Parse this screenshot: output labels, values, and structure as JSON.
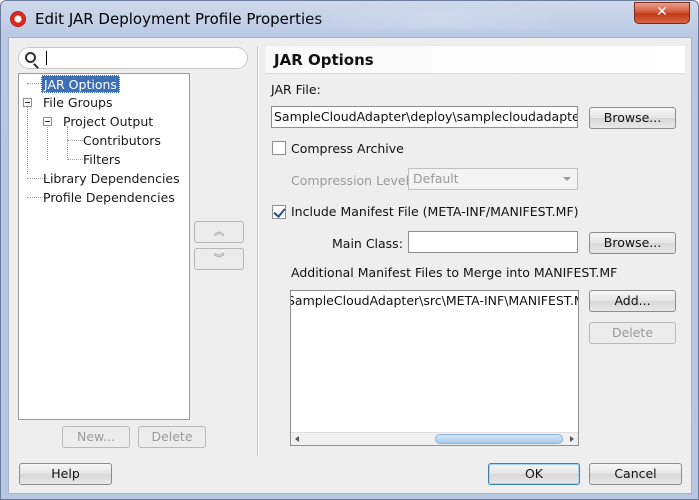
{
  "window": {
    "title": "Edit JAR Deployment Profile Properties",
    "close_symbol": "✕"
  },
  "sidebar": {
    "search": {
      "value": "",
      "placeholder": ""
    },
    "tree": [
      {
        "label": "JAR Options",
        "level": 0,
        "selected": true
      },
      {
        "label": "File Groups",
        "level": 0,
        "expanded": true
      },
      {
        "label": "Project Output",
        "level": 1,
        "expanded": true
      },
      {
        "label": "Contributors",
        "level": 2
      },
      {
        "label": "Filters",
        "level": 2
      },
      {
        "label": "Library Dependencies",
        "level": 0
      },
      {
        "label": "Profile Dependencies",
        "level": 0
      }
    ],
    "new_button": "New...",
    "delete_button": "Delete",
    "move_up_symbol": "︽",
    "move_down_symbol": "︾"
  },
  "main": {
    "section_title": "JAR Options",
    "jar_file_label": "JAR File:",
    "jar_file_value": "SampleCloudAdapter\\deploy\\samplecloudadapter.jar",
    "browse_label": "Browse...",
    "compress_label": "Compress Archive",
    "compress_checked": false,
    "compression_level_label": "Compression Level",
    "compression_level_value": "Default",
    "include_manifest_label": "Include Manifest File (META-INF/MANIFEST.MF)",
    "include_manifest_checked": true,
    "main_class_label": "Main Class:",
    "main_class_value": "",
    "main_class_browse_label": "Browse...",
    "additional_manifest_label": "Additional Manifest Files to Merge into MANIFEST.MF",
    "manifest_files": [
      "SampleCloudAdapter\\src\\META-INF\\MANIFEST.MF"
    ],
    "add_label": "Add...",
    "delete_label": "Delete"
  },
  "footer": {
    "help_label": "Help",
    "ok_label": "OK",
    "cancel_label": "Cancel"
  },
  "colors": {
    "selection": "#3d6fb5",
    "close_button": "#c1391a",
    "titlebar": "#b9c9e3"
  }
}
